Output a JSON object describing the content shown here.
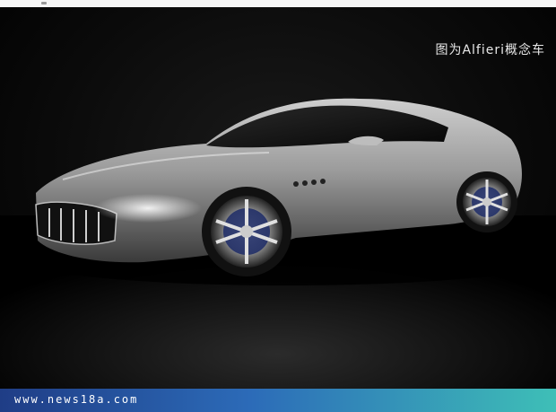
{
  "caption": "图为Alfieri概念车",
  "footer": {
    "url": "www.news18a.com"
  }
}
